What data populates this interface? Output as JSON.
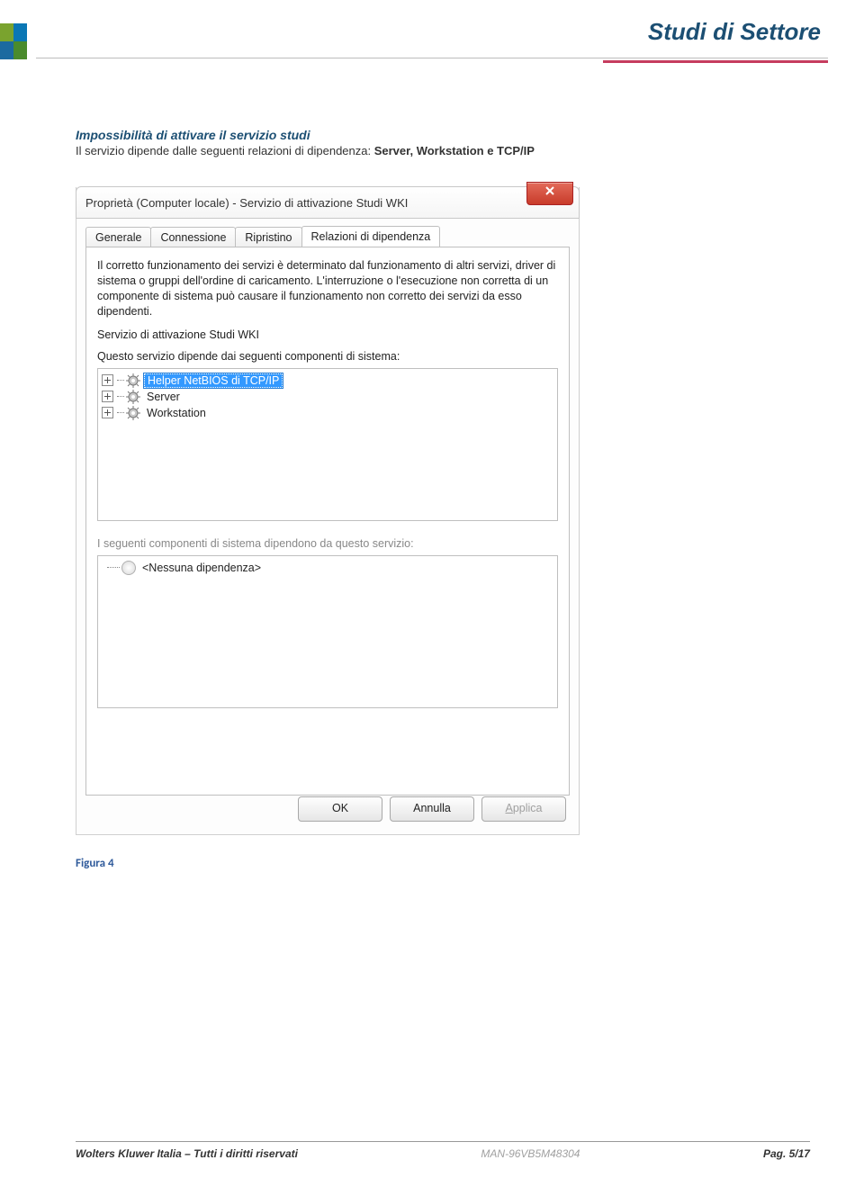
{
  "header": {
    "title": "Studi di Settore"
  },
  "section": {
    "heading": "Impossibilità di attivare il servizio studi",
    "line_prefix": "Il servizio dipende dalle seguenti relazioni di dipendenza: ",
    "line_bold": "Server, Workstation e TCP/IP"
  },
  "dialog": {
    "title": "Proprietà (Computer locale) - Servizio di attivazione Studi WKI",
    "tabs": [
      "Generale",
      "Connessione",
      "Ripristino",
      "Relazioni di dipendenza"
    ],
    "active_tab_index": 3,
    "description": "Il corretto funzionamento dei servizi è determinato dal funzionamento di altri servizi, driver di sistema o gruppi dell'ordine di caricamento. L'interruzione o l'esecuzione non corretta di un componente di sistema può causare il funzionamento non corretto dei servizi da esso dipendenti.",
    "service_name": "Servizio di attivazione Studi WKI",
    "depends_label": "Questo servizio dipende dai seguenti componenti di sistema:",
    "dependencies": [
      "Helper NetBIOS di TCP/IP",
      "Server",
      "Workstation"
    ],
    "selected_dependency_index": 0,
    "dependents_label": "I seguenti componenti di sistema dipendono da questo servizio:",
    "dependents_none": "<Nessuna dipendenza>",
    "buttons": {
      "ok": "OK",
      "cancel": "Annulla",
      "apply": "Applica"
    }
  },
  "caption": "Figura 4",
  "footer": {
    "left": "Wolters Kluwer Italia – Tutti i diritti riservati",
    "center": "MAN-96VB5M48304",
    "right": "Pag.  5/17"
  }
}
